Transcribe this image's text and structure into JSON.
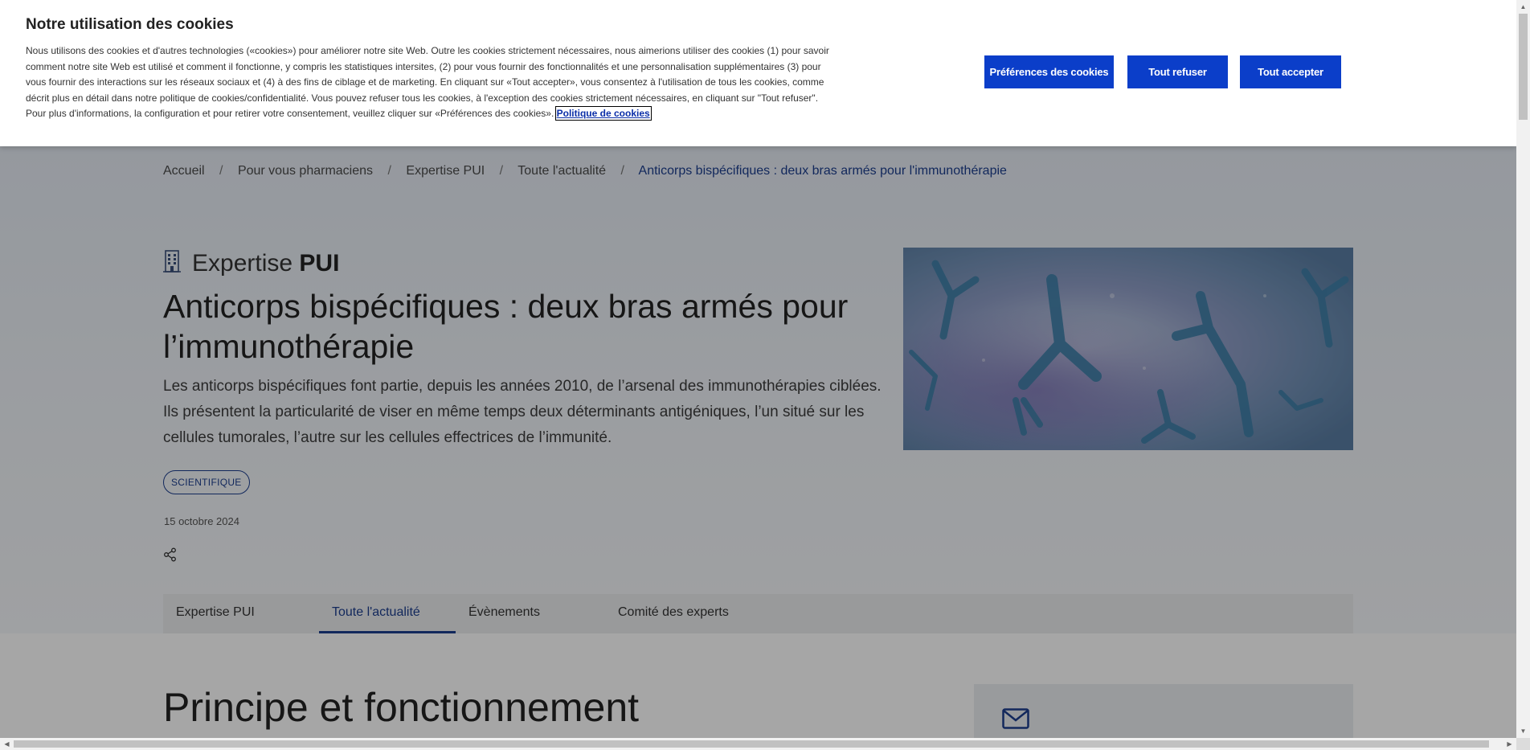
{
  "breadcrumb": {
    "items": [
      "Accueil",
      "Pour vous pharmaciens",
      "Expertise PUI",
      "Toute l'actualité"
    ],
    "separator": "/",
    "current": "Anticorps bispécifiques : deux bras armés pour l'immunothérapie"
  },
  "article": {
    "category_light": "Expertise",
    "category_bold": "PUI",
    "title": "Anticorps bispécifiques : deux bras armés pour l’immunothérapie",
    "lead": "Les anticorps bispécifiques font partie, depuis les années 2010, de l’arsenal des immunothérapies ciblées. Ils présentent la particularité de viser en même temps deux déterminants antigéniques, l’un situé sur les cellules tumorales, l’autre sur les cellules effectrices de l’immunité.",
    "tag": "SCIENTIFIQUE",
    "date": "15 octobre 2024"
  },
  "tabs": [
    {
      "label": "Expertise PUI",
      "active": false
    },
    {
      "label": "Toute l'actualité",
      "active": true
    },
    {
      "label": "Évènements",
      "active": false
    },
    {
      "label": "Comité des experts",
      "active": false
    }
  ],
  "section": {
    "title": "Principe et fonctionnement"
  },
  "cookie": {
    "title": "Notre utilisation des cookies",
    "text": "Nous utilisons des cookies et d'autres technologies («cookies») pour améliorer notre site Web. Outre les cookies strictement nécessaires, nous aimerions utiliser des cookies (1) pour savoir comment notre site Web est utilisé et comment il fonctionne, y compris les statistiques intersites, (2) pour vous fournir des fonctionnalités et une personnalisation supplémentaires (3) pour vous fournir des interactions sur les réseaux sociaux et (4) à des fins de ciblage et de marketing. En cliquant sur «Tout accepter», vous consentez à l'utilisation de tous les cookies, comme décrit plus en détail dans notre politique de cookies/confidentialité. Vous pouvez refuser tous les cookies, à l'exception des cookies strictement nécessaires, en cliquant sur \"Tout refuser\". Pour plus d'informations, la configuration et pour retirer votre consentement, veuillez cliquer sur «Préférences des cookies».",
    "policy_link": "Politique de cookies",
    "buttons": {
      "preferences": "Préférences des cookies",
      "reject": "Tout refuser",
      "accept": "Tout accepter"
    }
  },
  "colors": {
    "accent": "#1d3e8e",
    "button": "#0b3ec9",
    "overlay": "rgba(0,0,0,0.35)"
  },
  "icons": {
    "category": "building-icon",
    "share": "share-icon",
    "newsletter": "mail-icon"
  }
}
